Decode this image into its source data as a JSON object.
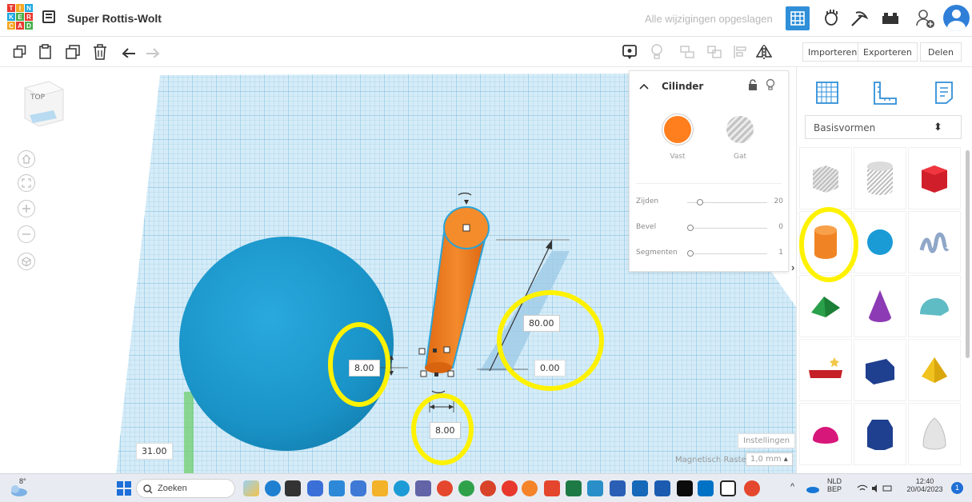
{
  "app": {
    "logo_letters": [
      "T",
      "I",
      "N",
      "K",
      "E",
      "R",
      "C",
      "A",
      "D"
    ],
    "document_title": "Super Rottis-Wolt",
    "save_status": "Alle wijzigingen opgeslagen",
    "accent_color": "#2f8fd8"
  },
  "toolbar": {
    "import_label": "Importeren",
    "export_label": "Exporteren",
    "share_label": "Delen"
  },
  "viewcube": {
    "face_label": "TOP"
  },
  "workplane": {
    "dimensions": {
      "elevation": "8.00",
      "height": "80.00",
      "offset": "0.00",
      "width": "8.00",
      "side": "31.00"
    },
    "settings_label": "Instellingen",
    "snap_label": "Magnetisch Raster",
    "snap_value": "1,0 mm"
  },
  "inspector": {
    "title": "Cilinder",
    "solid_label": "Vast",
    "hole_label": "Gat",
    "solid_color": "#ff7f1f",
    "properties": [
      {
        "label": "Zijden",
        "value": "20"
      },
      {
        "label": "Bevel",
        "value": "0"
      },
      {
        "label": "Segmenten",
        "value": "1"
      }
    ]
  },
  "library": {
    "category": "Basisvormen",
    "shapes": [
      "box-hole",
      "cylinder-hole",
      "box",
      "cylinder",
      "sphere",
      "scribble",
      "roof",
      "cone",
      "round-roof",
      "text",
      "wedge",
      "pyramid",
      "half-sphere",
      "polygon",
      "paraboloid"
    ]
  },
  "taskbar": {
    "temperature": "8°",
    "search_label": "Zoeken",
    "language": "NLD",
    "keyboard": "BEP",
    "time": "12:40",
    "date": "20/04/2023",
    "notification_count": "1"
  }
}
